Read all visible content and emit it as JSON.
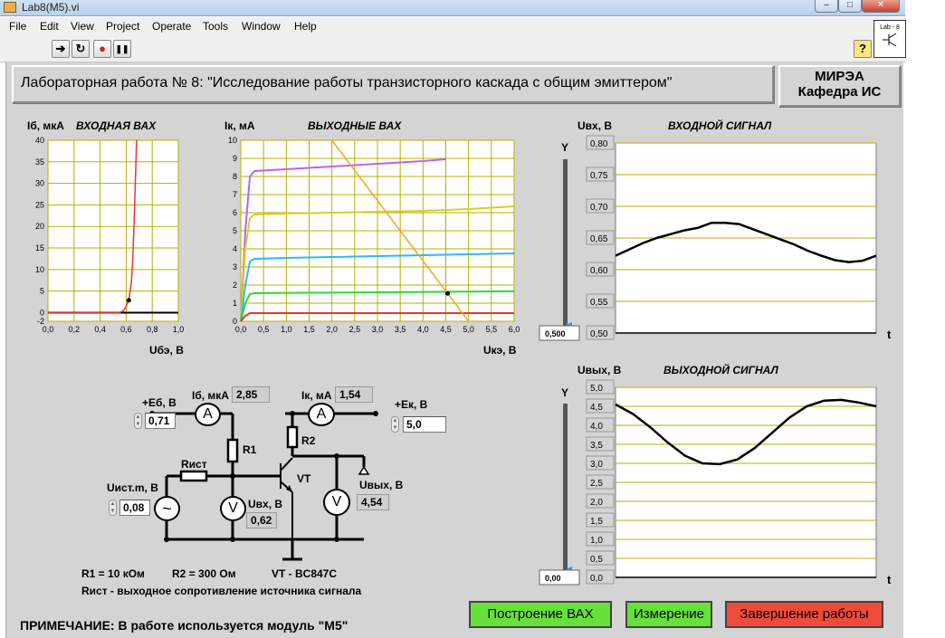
{
  "window": {
    "title": "Lab8(M5).vi",
    "minimize": "–",
    "maximize": "□",
    "close": "✕"
  },
  "menu": [
    "File",
    "Edit",
    "View",
    "Project",
    "Operate",
    "Tools",
    "Window",
    "Help"
  ],
  "toolbar": {
    "run": "➔",
    "run_cont": "↻",
    "abort": "●",
    "pause": "❚❚",
    "help": "?"
  },
  "header": {
    "title": "Лабораторная работа № 8: \"Исследование работы транзисторного каскада с общим эмиттером\"",
    "org_line1": "МИРЭА",
    "org_line2": "Кафедра ИС",
    "icon_text": "Lab - 8"
  },
  "input_iv": {
    "title": "ВХОДНАЯ ВАХ",
    "ylabel": "Iб, мкА",
    "xlabel": "Uбэ, В",
    "yticks": [
      "40",
      "35",
      "30",
      "25",
      "20",
      "15",
      "10",
      "5",
      "0",
      "-2"
    ],
    "xticks": [
      "0,0",
      "0,2",
      "0,4",
      "0,6",
      "0,8",
      "1,0"
    ]
  },
  "output_iv": {
    "title": "ВЫХОДНЫЕ ВАХ",
    "ylabel": "Iк, мА",
    "xlabel": "Uкэ, В",
    "yticks": [
      "10",
      "9",
      "8",
      "7",
      "6",
      "5",
      "4",
      "3",
      "2",
      "1",
      "0"
    ],
    "xticks": [
      "0,0",
      "0,5",
      "1,0",
      "1,5",
      "2,0",
      "2,5",
      "3,0",
      "3,5",
      "4,0",
      "4,5",
      "5,0",
      "5,5",
      "6,0"
    ]
  },
  "input_signal": {
    "title": "ВХОДНОЙ СИГНАЛ",
    "ylabel": "Uвх, В",
    "yticks": [
      "0,80",
      "0,75",
      "0,70",
      "0,65",
      "0,60",
      "0,55",
      "0,50"
    ],
    "t_label": "t",
    "y_axis": "Y",
    "scale_value": "0,500"
  },
  "output_signal": {
    "title": "ВЫХОДНОЙ СИГНАЛ",
    "ylabel": "Uвых, В",
    "yticks": [
      "5,0",
      "4,5",
      "4,0",
      "3,5",
      "3,0",
      "2,5",
      "2,0",
      "1,5",
      "1,0",
      "0,5",
      "0,0"
    ],
    "t_label": "t",
    "y_axis": "Y",
    "scale_value": "0,00"
  },
  "circuit": {
    "eb_label": "+Eб, В",
    "eb_value": "0,71",
    "ib_label": "Iб, мкА",
    "ib_value": "2,85",
    "ik_label": "Iк, мА",
    "ik_value": "1,54",
    "ek_label": "+Eк, В",
    "ek_value": "5,0",
    "uist_label": "Uист.m, В",
    "uist_value": "0,08",
    "uvx_label": "Uвх, В",
    "uvx_value": "0,62",
    "uvyx_label": "Uвых, В",
    "uvyx_value": "4,54",
    "r1": "R1",
    "r2": "R2",
    "rist": "Rист",
    "vt": "VT",
    "ammeter": "A",
    "voltmeter": "V",
    "source": "~"
  },
  "notes": {
    "r1": "R1 = 10 кОм",
    "r2": "R2 =  300 Ом",
    "vt": "VT - BC847C",
    "rist": "Rист - выходное сопротивление источника сигнала",
    "remark": "ПРИМЕЧАНИЕ: В работе используется модуль \"М5\""
  },
  "buttons": {
    "build": "Построение ВАХ",
    "measure": "Измерение",
    "finish": "Завершение работы"
  },
  "colors": {
    "panel": "#d4d4d4",
    "plot_bg": "#ffffff",
    "grid": "#b5b000",
    "green_btn": "#66e03a",
    "red_btn": "#f04a3a",
    "curve_red": "#f03030",
    "curve_violet": "#c060f0",
    "curve_yellow": "#d8d020",
    "curve_cyan": "#30b8f0",
    "curve_green": "#30d830",
    "load_line": "#f0a820"
  },
  "chart_data": [
    {
      "type": "line",
      "title": "ВХОДНАЯ ВАХ",
      "xlabel": "Uбэ, В",
      "ylabel": "Iб, мкА",
      "xlim": [
        0,
        1
      ],
      "ylim": [
        -2,
        40
      ],
      "series": [
        {
          "x": [
            0,
            0.55,
            0.58,
            0.6,
            0.62,
            0.64,
            0.65,
            0.66,
            0.67,
            0.68
          ],
          "y": [
            0,
            0,
            0.5,
            1.5,
            3,
            7,
            12,
            20,
            30,
            40
          ]
        }
      ],
      "point": {
        "x": 0.62,
        "y": 2.85
      }
    },
    {
      "type": "line",
      "title": "ВЫХОДНЫЕ ВАХ",
      "xlabel": "Uкэ, В",
      "ylabel": "Iк, мА",
      "xlim": [
        0,
        6
      ],
      "ylim": [
        0,
        10
      ],
      "series": [
        {
          "x": [
            0,
            0.1,
            0.2,
            0.3,
            1,
            2,
            3,
            4,
            4.5
          ],
          "y": [
            0,
            5,
            8,
            8.3,
            8.4,
            8.55,
            8.7,
            8.85,
            8.95
          ]
        },
        {
          "x": [
            0,
            0.1,
            0.2,
            0.3,
            1,
            2,
            3,
            4,
            5,
            6
          ],
          "y": [
            0,
            4,
            5.7,
            5.9,
            5.95,
            6.0,
            6.05,
            6.1,
            6.2,
            6.35
          ]
        },
        {
          "x": [
            0,
            0.1,
            0.2,
            0.3,
            1,
            2,
            3,
            4,
            5,
            6
          ],
          "y": [
            0,
            2,
            3.3,
            3.45,
            3.5,
            3.55,
            3.6,
            3.65,
            3.7,
            3.75
          ]
        },
        {
          "x": [
            0,
            0.1,
            0.2,
            0.3,
            1,
            2,
            3,
            4,
            5,
            6
          ],
          "y": [
            0,
            1,
            1.5,
            1.55,
            1.57,
            1.58,
            1.6,
            1.62,
            1.64,
            1.66
          ]
        },
        {
          "x": [
            0,
            0.1,
            0.2,
            6
          ],
          "y": [
            0,
            0.3,
            0.45,
            0.45
          ]
        }
      ],
      "load_line": {
        "x": [
          2,
          5
        ],
        "y": [
          10,
          0
        ]
      },
      "point": {
        "x": 4.54,
        "y": 1.54
      }
    },
    {
      "type": "line",
      "title": "ВХОДНОЙ СИГНАЛ",
      "ylabel": "Uвх, В",
      "ylim": [
        0.5,
        0.8
      ],
      "series": [
        {
          "values": [
            0.622,
            0.632,
            0.642,
            0.65,
            0.656,
            0.662,
            0.666,
            0.674,
            0.674,
            0.672,
            0.664,
            0.656,
            0.648,
            0.64,
            0.63,
            0.622,
            0.615,
            0.612,
            0.614,
            0.622
          ]
        }
      ]
    },
    {
      "type": "line",
      "title": "ВЫХОДНОЙ СИГНАЛ",
      "ylabel": "Uвых, В",
      "ylim": [
        0,
        5
      ],
      "series": [
        {
          "values": [
            4.55,
            4.3,
            3.95,
            3.55,
            3.2,
            3.0,
            2.98,
            3.1,
            3.4,
            3.8,
            4.2,
            4.5,
            4.65,
            4.67,
            4.6,
            4.5
          ]
        }
      ]
    }
  ]
}
